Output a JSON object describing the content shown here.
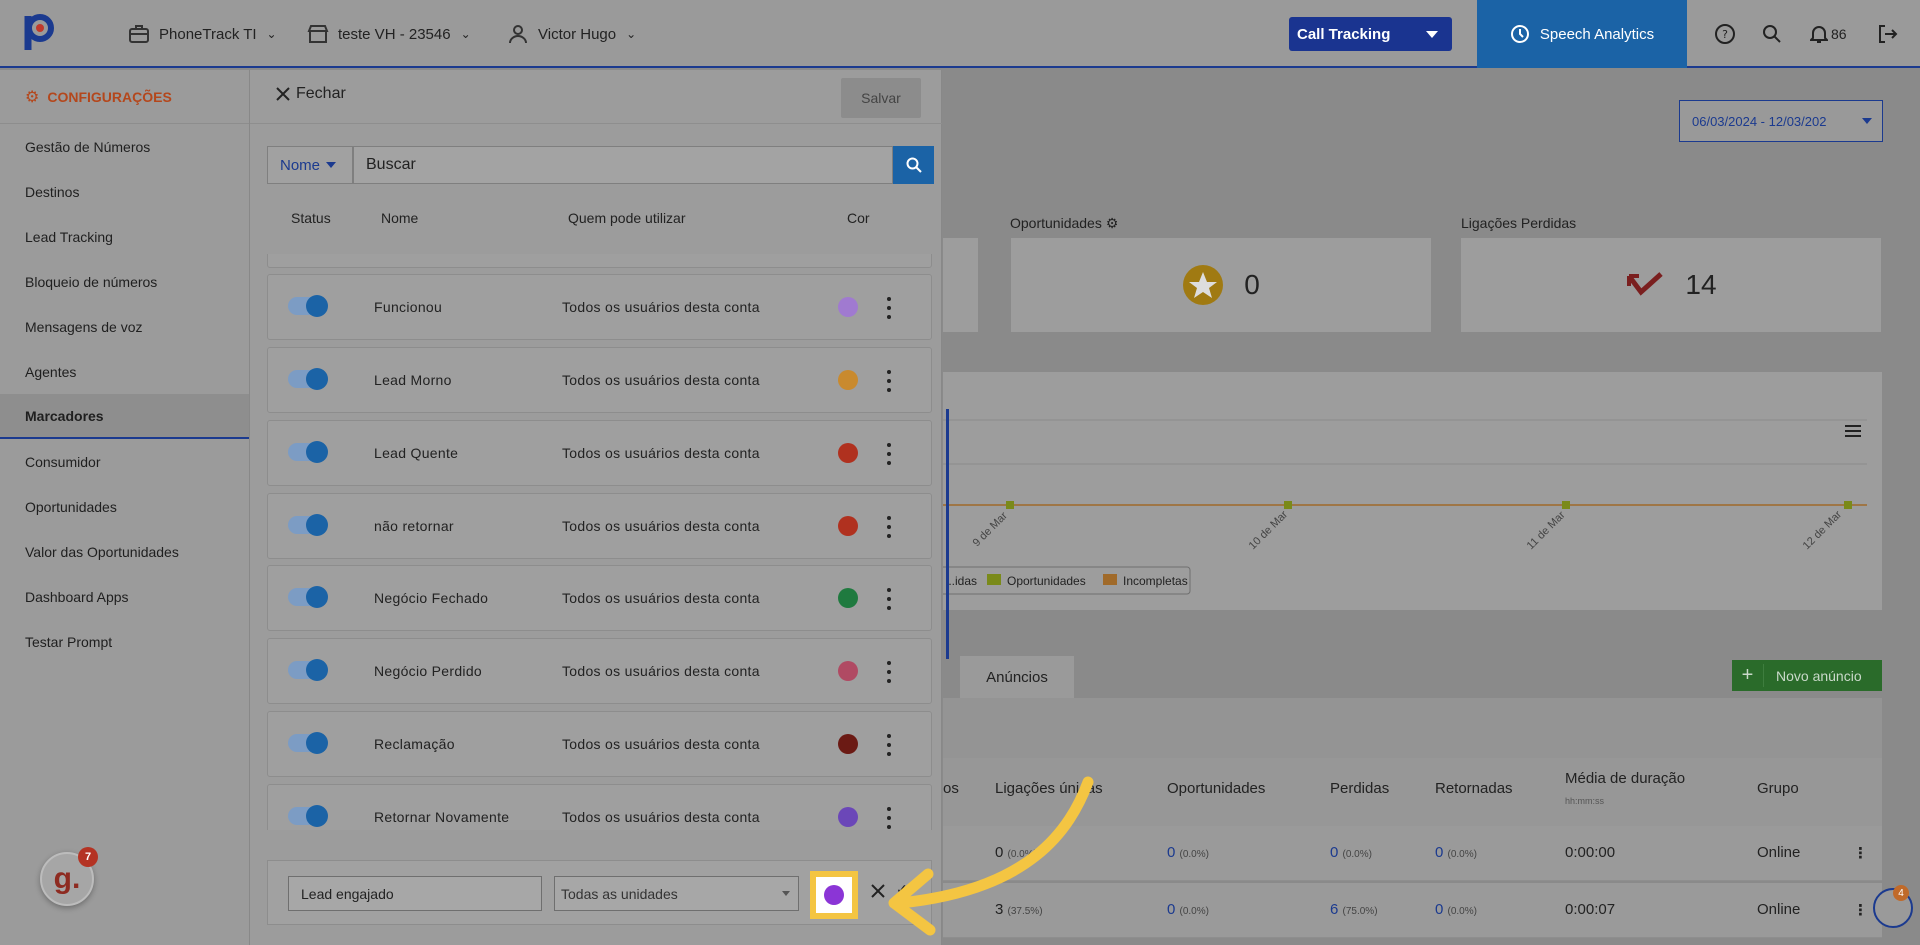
{
  "topbar": {
    "company": "PhoneTrack TI",
    "account": "teste VH - 23546",
    "user": "Victor Hugo",
    "product_select": "Call Tracking",
    "speech_analytics": "Speech Analytics",
    "notifications_count": "86"
  },
  "sidebar": {
    "title": "CONFIGURAÇÕES",
    "items": [
      {
        "label": "Gestão de Números"
      },
      {
        "label": "Destinos"
      },
      {
        "label": "Lead Tracking"
      },
      {
        "label": "Bloqueio de números"
      },
      {
        "label": "Mensagens de voz"
      },
      {
        "label": "Agentes"
      },
      {
        "label": "Marcadores",
        "active": true
      },
      {
        "label": "Consumidor"
      },
      {
        "label": "Oportunidades"
      },
      {
        "label": "Valor das Oportunidades"
      },
      {
        "label": "Dashboard Apps"
      },
      {
        "label": "Testar Prompt"
      }
    ]
  },
  "modal": {
    "close_label": "Fechar",
    "save_label": "Salvar",
    "filter_field": "Nome",
    "search_placeholder": "Buscar",
    "columns": {
      "status": "Status",
      "name": "Nome",
      "who": "Quem pode utilizar",
      "color": "Cor"
    },
    "rows": [
      {
        "name": "Funcionou",
        "who": "Todos os usuários desta conta",
        "color": "#a07ad0",
        "enabled": true
      },
      {
        "name": "Lead Morno",
        "who": "Todos os usuários desta conta",
        "color": "#c98a2e",
        "enabled": true
      },
      {
        "name": "Lead Quente",
        "who": "Todos os usuários desta conta",
        "color": "#b0311f",
        "enabled": true
      },
      {
        "name": "não retornar",
        "who": "Todos os usuários desta conta",
        "color": "#b0311f",
        "enabled": true
      },
      {
        "name": "Negócio Fechado",
        "who": "Todos os usuários desta conta",
        "color": "#1f7a3f",
        "enabled": true
      },
      {
        "name": "Negócio Perdido",
        "who": "Todos os usuários desta conta",
        "color": "#b04a63",
        "enabled": true
      },
      {
        "name": "Reclamação",
        "who": "Todos os usuários desta conta",
        "color": "#6b1a14",
        "enabled": true
      },
      {
        "name": "Retornar Novamente",
        "who": "Todos os usuários desta conta",
        "color": "#6b47b8",
        "enabled": true
      }
    ],
    "new_marker": {
      "name_value": "Lead engajado",
      "units_value": "Todas as unidades",
      "color": "#8b35d6"
    }
  },
  "dashboard": {
    "date_range": "06/03/2024 - 12/03/202",
    "kpis": [
      {
        "label": "Oportunidades",
        "value": "0"
      },
      {
        "label": "Ligações Perdidas",
        "value": "14"
      }
    ],
    "chart": {
      "x_ticks": [
        "9 de Mar",
        "10 de Mar",
        "11 de Mar",
        "12 de Mar"
      ],
      "legend": [
        "...idas",
        "Oportunidades",
        "Incompletas"
      ]
    },
    "tab_anuncios": "Anúncios",
    "new_ad_button": "Novo anúncio",
    "table": {
      "headers": [
        "os",
        "Ligações únicas",
        "Oportunidades",
        "Perdidas",
        "Retornadas",
        "Média de duração",
        "Grupo"
      ],
      "duration_sub": "hh:mm:ss",
      "rows": [
        {
          "unique": "0",
          "unique_pct": "(0.0%)",
          "opp": "0",
          "opp_pct": "(0.0%)",
          "lost": "0",
          "lost_pct": "(0.0%)",
          "ret": "0",
          "ret_pct": "(0.0%)",
          "duration": "0:00:00",
          "group": "Online"
        },
        {
          "unique": "3",
          "unique_pct": "(37.5%)",
          "opp": "0",
          "opp_pct": "(0.0%)",
          "lost": "6",
          "lost_pct": "(75.0%)",
          "ret": "0",
          "ret_pct": "(0.0%)",
          "duration": "0:00:07",
          "group": "Online"
        }
      ]
    }
  },
  "badges": {
    "g_count": "7",
    "p_count": "4"
  },
  "colors": {
    "brand_blue": "#1b3a8f",
    "accent_blue": "#1b63a6",
    "highlight": "#f4c542"
  }
}
